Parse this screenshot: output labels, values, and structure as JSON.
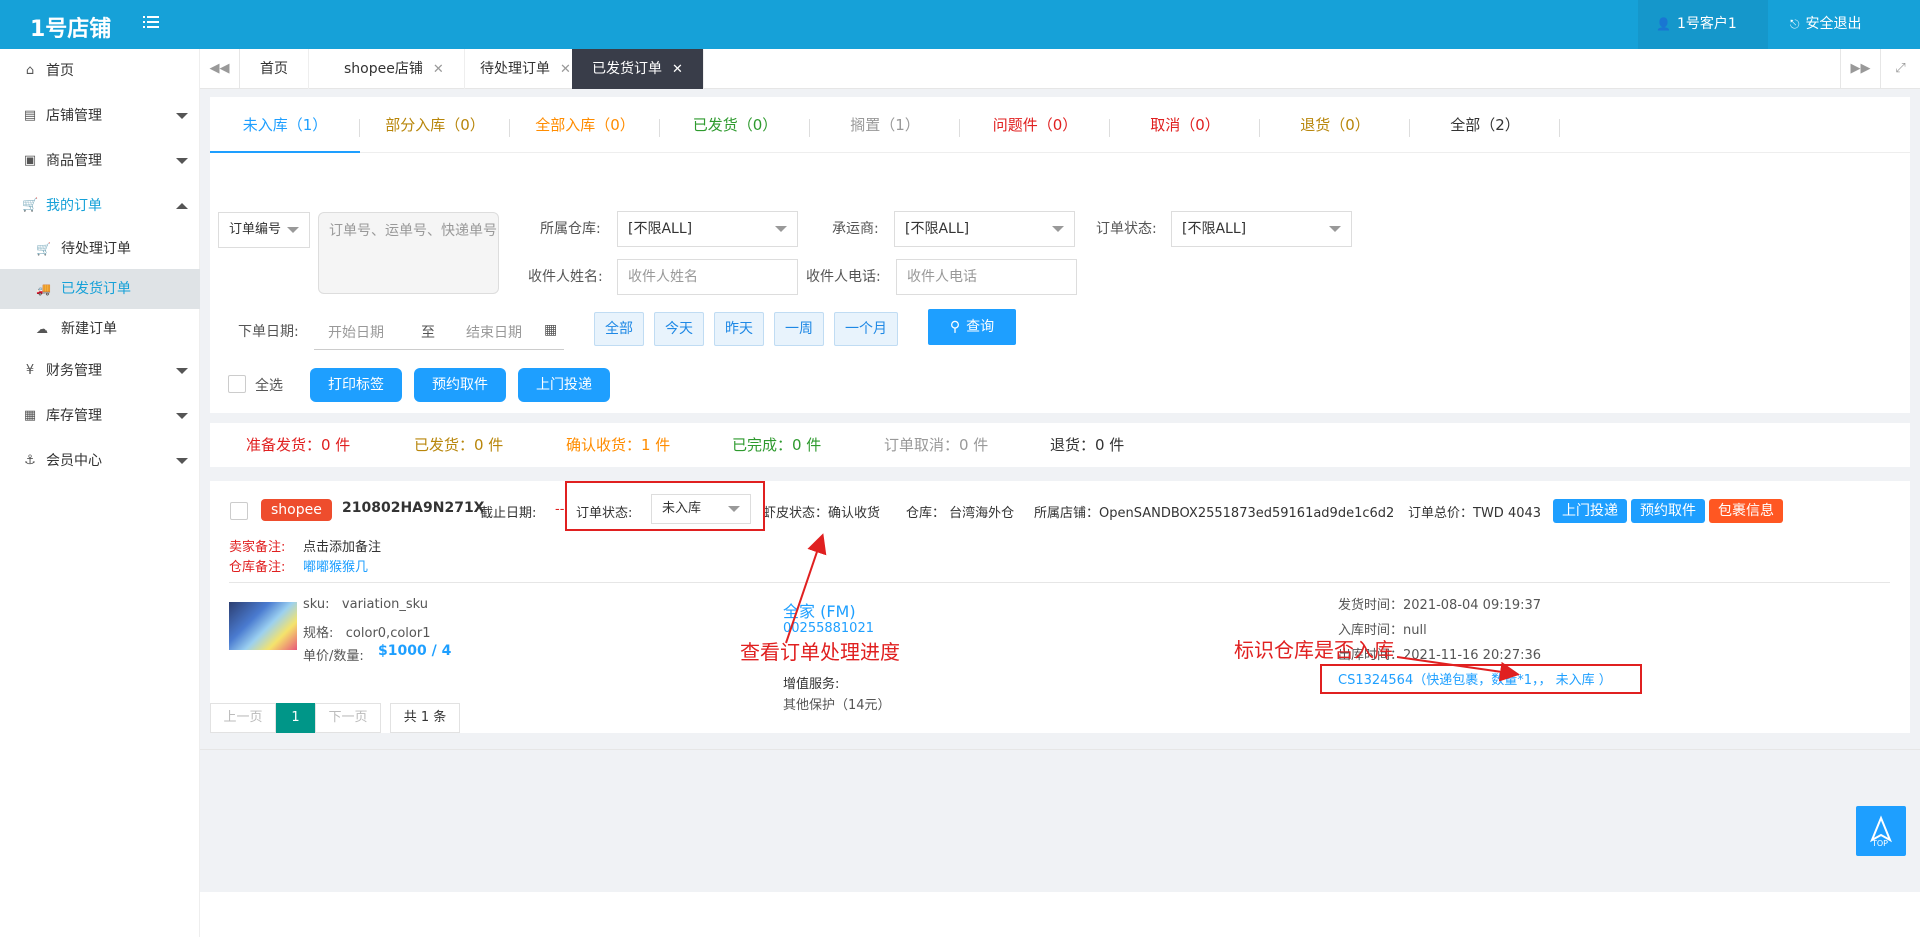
{
  "header": {
    "brand": "1号店铺",
    "user_label": "1号客户1",
    "logout_label": "安全退出"
  },
  "sidebar": {
    "items": [
      {
        "label": "首页"
      },
      {
        "label": "店铺管理"
      },
      {
        "label": "商品管理"
      },
      {
        "label": "我的订单"
      },
      {
        "label": "待处理订单"
      },
      {
        "label": "已发货订单"
      },
      {
        "label": "新建订单"
      },
      {
        "label": "财务管理"
      },
      {
        "label": "库存管理"
      },
      {
        "label": "会员中心"
      }
    ]
  },
  "tabs": [
    {
      "label": "首页"
    },
    {
      "label": "shopee店铺"
    },
    {
      "label": "待处理订单"
    },
    {
      "label": "已发货订单"
    }
  ],
  "status_tabs": [
    {
      "label": "未入库（1）",
      "color": "#1e9fff"
    },
    {
      "label": "部分入库（0）",
      "color": "#b8860b"
    },
    {
      "label": "全部入库（0）",
      "color": "#ff8c00"
    },
    {
      "label": "已发货（0）",
      "color": "#2e9a2e"
    },
    {
      "label": "搁置（1）",
      "color": "#999999"
    },
    {
      "label": "问题件（0）",
      "color": "#e02020"
    },
    {
      "label": "取消（0）",
      "color": "#e02020"
    },
    {
      "label": "退货（0）",
      "color": "#b8860b"
    },
    {
      "label": "全部（2）",
      "color": "#333333"
    }
  ],
  "filters": {
    "order_no_select": "订单编号",
    "order_no_placeholder": "订单号、运单号、快递单号",
    "warehouse_label": "所属仓库:",
    "warehouse_value": "[不限ALL]",
    "carrier_label": "承运商:",
    "carrier_value": "[不限ALL]",
    "status_label": "订单状态:",
    "status_value": "[不限ALL]",
    "receiver_name_label": "收件人姓名:",
    "receiver_name_placeholder": "收件人姓名",
    "receiver_phone_label": "收件人电话:",
    "receiver_phone_placeholder": "收件人电话",
    "date_label": "下单日期:",
    "start_placeholder": "开始日期",
    "to_label": "至",
    "end_placeholder": "结束日期",
    "quick": [
      "全部",
      "今天",
      "昨天",
      "一周",
      "一个月"
    ],
    "search_label": "查询"
  },
  "actions": {
    "select_all": "全选",
    "print": "打印标签",
    "pickup": "预约取件",
    "dropoff": "上门投递"
  },
  "counters": [
    {
      "label": "准备发货：0 件",
      "color": "#e02020"
    },
    {
      "label": "已发货：0 件",
      "color": "#b8860b"
    },
    {
      "label": "确认收货：1 件",
      "color": "#ff8c00"
    },
    {
      "label": "已完成：0 件",
      "color": "#2e9a2e"
    },
    {
      "label": "订单取消：0 件",
      "color": "#999999"
    },
    {
      "label": "退货：0 件",
      "color": "#333333"
    }
  ],
  "order": {
    "platform": "shopee",
    "order_no": "210802HA9N271X",
    "deadline_label": "截止日期:",
    "deadline_value": "--",
    "status_label": "订单状态:",
    "status_value": "未入库",
    "shopee_status": "虾皮状态：确认收货",
    "warehouse": "仓库：  台湾海外仓",
    "store": "所属店铺：OpenSANDBOX2551873ed59161ad9de1c6d2",
    "total": "订单总价：TWD 4043",
    "btn_dropoff": "上门投递",
    "btn_pickup": "预约取件",
    "btn_package": "包裹信息",
    "seller_note_label": "卖家备注:",
    "seller_note_value": "点击添加备注",
    "warehouse_note_label": "仓库备注:",
    "warehouse_note_value": "嘟嘟猴猴几",
    "sku": "sku:   variation_sku",
    "spec": "规格:   color0,color1",
    "price_label": "单价/数量:",
    "price_value": "$1000 / 4",
    "carrier_name": "全家 (FM)",
    "tracking_no": "00255881021",
    "vas_label": "增值服务:",
    "vas_value": "其他保护（14元）",
    "ship_time": "发货时间：2021-08-04 09:19:37",
    "in_time": "入库时间：null",
    "out_time": "出库时间：2021-11-16 20:27:36",
    "package_info": "CS1324564（快递包裹，数量*1，， 未入库 ）"
  },
  "annotations": {
    "progress": "查看订单处理进度",
    "warehouse_in": "标识仓库是否入库"
  },
  "pagination": {
    "prev": "上一页",
    "current": "1",
    "next": "下一页",
    "total": "共 1 条"
  },
  "top_button": "TOP"
}
